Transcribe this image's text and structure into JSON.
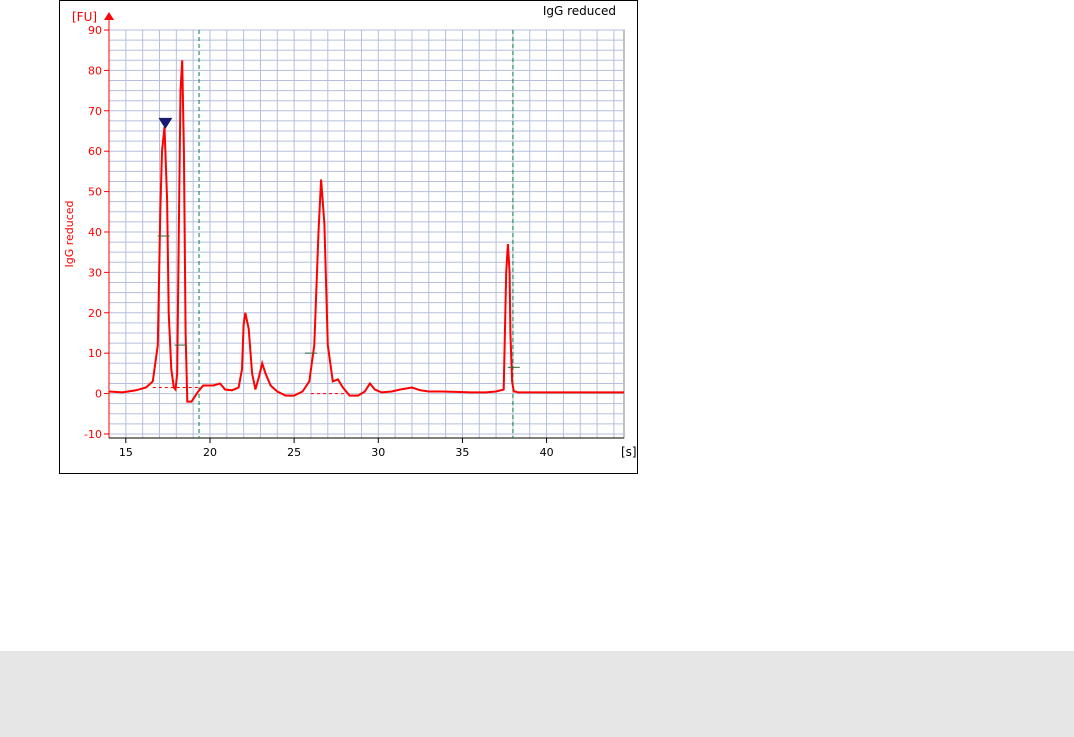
{
  "chart_data": {
    "type": "line",
    "title": "IgG reduced",
    "ylabel": "IgG reduced",
    "y_unit": "[FU]",
    "x_unit": "[s]",
    "xlim": [
      14,
      44.6
    ],
    "ylim": [
      -11,
      90
    ],
    "x_ticks": [
      15,
      20,
      25,
      30,
      35,
      40
    ],
    "y_ticks": [
      -10,
      0,
      10,
      20,
      30,
      40,
      50,
      60,
      70,
      80,
      90
    ],
    "grid": true,
    "series": [
      {
        "x": [
          14.0,
          14.8,
          15.6,
          16.2,
          16.6,
          16.9,
          17.05,
          17.15,
          17.3,
          17.45,
          17.55,
          17.7,
          17.85,
          17.95,
          18.05,
          18.15,
          18.25,
          18.35,
          18.45,
          18.55,
          18.65,
          18.9,
          19.3,
          19.6,
          20.2,
          20.6,
          20.9,
          21.3,
          21.7,
          21.9,
          22.0,
          22.1,
          22.3,
          22.5,
          22.7,
          22.9,
          23.1,
          23.3,
          23.6,
          24.0,
          24.5,
          25.0,
          25.5,
          25.9,
          26.2,
          26.45,
          26.6,
          26.8,
          27.0,
          27.3,
          27.6,
          27.9,
          28.3,
          28.8,
          29.2,
          29.5,
          29.8,
          30.2,
          30.8,
          31.3,
          32.0,
          32.5,
          33.0,
          33.8,
          34.6,
          35.5,
          36.4,
          37.0,
          37.45,
          37.6,
          37.7,
          37.8,
          37.85,
          37.95,
          38.05,
          38.15,
          38.3,
          38.6,
          39.5,
          44.6
        ],
        "y": [
          0.5,
          0.3,
          0.8,
          1.5,
          3.0,
          12.0,
          45.0,
          60.0,
          66.0,
          48.0,
          20.0,
          6.0,
          1.5,
          1.0,
          5.0,
          40.0,
          75.0,
          82.5,
          60.0,
          15.0,
          -2.0,
          -2.0,
          0.5,
          2.0,
          2.0,
          2.5,
          1.0,
          0.8,
          1.5,
          6.0,
          17.0,
          20.0,
          16.0,
          5.0,
          1.0,
          4.0,
          7.5,
          5.0,
          2.0,
          0.5,
          -0.5,
          -0.5,
          0.5,
          3.0,
          12.0,
          40.0,
          53.0,
          42.0,
          12.0,
          3.0,
          3.5,
          1.5,
          -0.5,
          -0.5,
          0.5,
          2.5,
          1.0,
          0.3,
          0.5,
          1.0,
          1.5,
          0.8,
          0.5,
          0.5,
          0.4,
          0.3,
          0.3,
          0.5,
          1.0,
          30.0,
          37.0,
          30.0,
          15.0,
          3.0,
          0.5,
          0.5,
          0.3,
          0.3,
          0.3,
          0.3
        ]
      }
    ],
    "peak_marker_x": 17.35,
    "peak_marker_y": 66.5,
    "boundary_lines_x": [
      19.35,
      38.0
    ],
    "peak_dashes": [
      {
        "x": 17.25,
        "y": 39
      },
      {
        "x": 18.25,
        "y": 12
      },
      {
        "x": 26.0,
        "y": 10
      },
      {
        "x": 38.05,
        "y": 6.5
      }
    ],
    "colors": {
      "trace": "#ff0000",
      "axis": "#ff0000",
      "grid": "#b4bfdb",
      "boundary": "#00804d",
      "marker": "#1a1a6e",
      "baseline": "#ff0000"
    }
  }
}
